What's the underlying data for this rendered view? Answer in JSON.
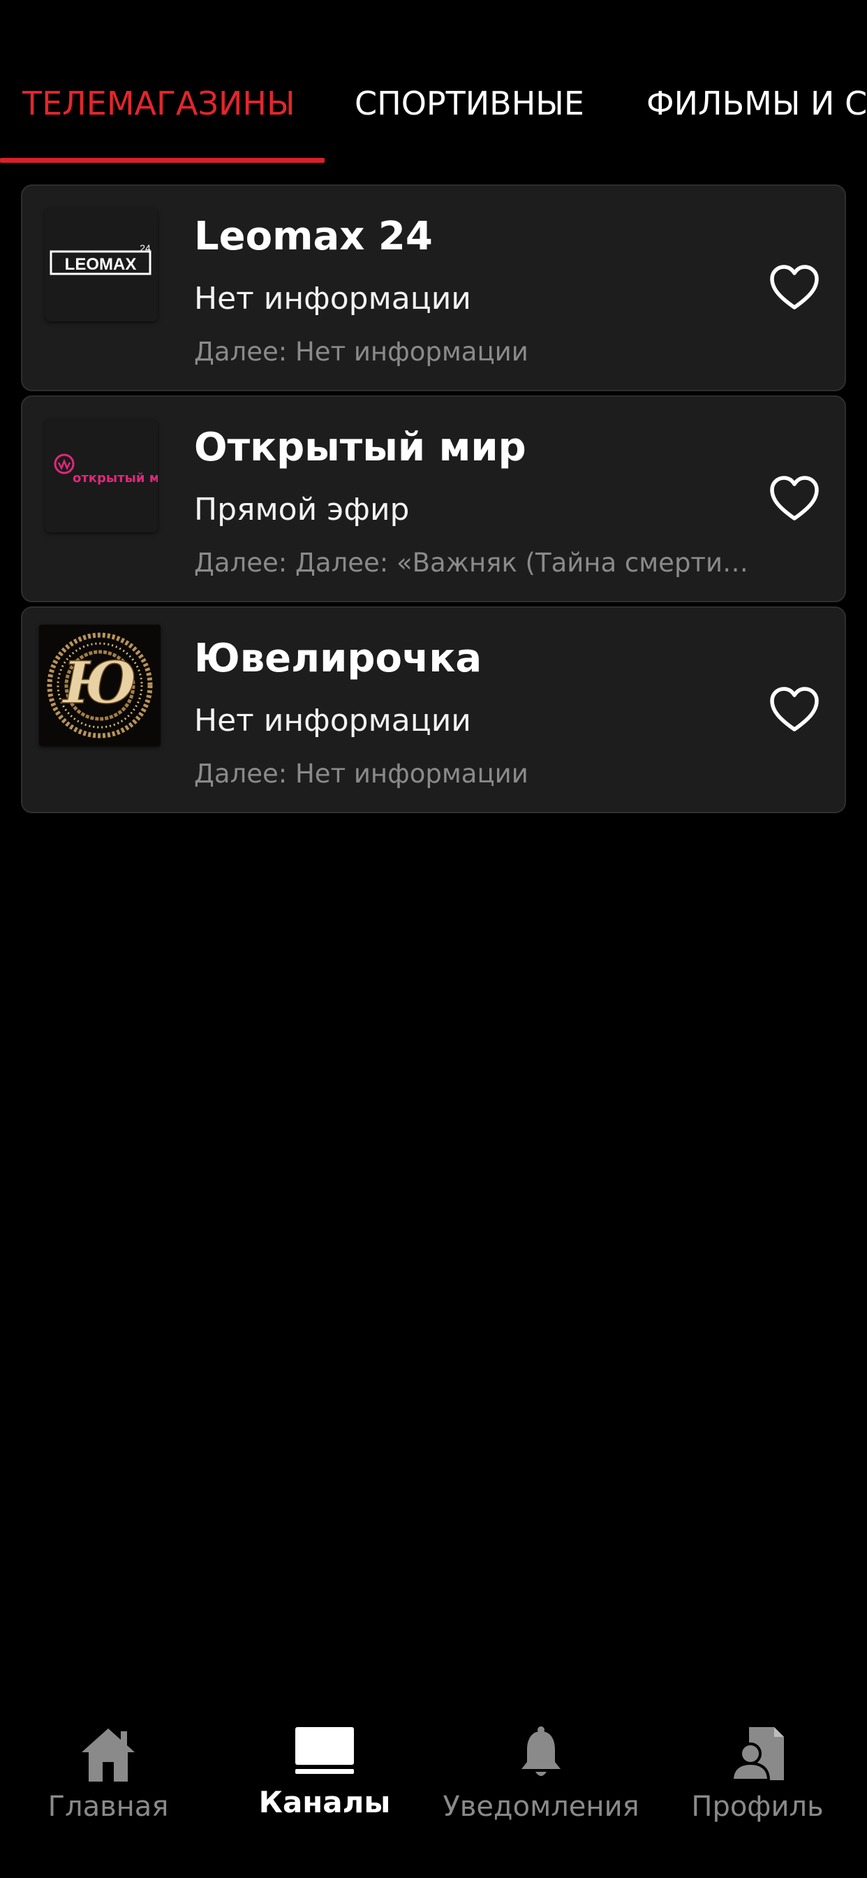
{
  "tabs": [
    {
      "label": "ТЕЛЕМАГАЗИНЫ",
      "active": true
    },
    {
      "label": "СПОРТИВНЫЕ",
      "active": false
    },
    {
      "label": "ФИЛЬМЫ И С",
      "active": false
    }
  ],
  "channels": [
    {
      "name": "Leomax 24",
      "now": "Нет информации",
      "next": "Далее: Нет информации",
      "logo_text": "LEOMAX",
      "logo_sup": "24",
      "favorite": false
    },
    {
      "name": "Открытый мир",
      "now": "Прямой эфир",
      "next": "Далее: Далее: «Важняк (Тайна смерти…",
      "logo_text": "открытый мир",
      "favorite": false
    },
    {
      "name": "Ювелирочка",
      "now": "Нет информации",
      "next": "Далее: Нет информации",
      "logo_text": "Ю",
      "favorite": false
    }
  ],
  "bottom_nav": [
    {
      "label": "Главная",
      "icon": "home-icon",
      "active": false
    },
    {
      "label": "Каналы",
      "icon": "tv-icon",
      "active": true
    },
    {
      "label": "Уведомления",
      "icon": "bell-icon",
      "active": false
    },
    {
      "label": "Профиль",
      "icon": "profile-icon",
      "active": false
    }
  ],
  "colors": {
    "background": "#000000",
    "card": "#1d1d1d",
    "accent": "#e3262d",
    "muted_text": "#8a8a8a"
  }
}
